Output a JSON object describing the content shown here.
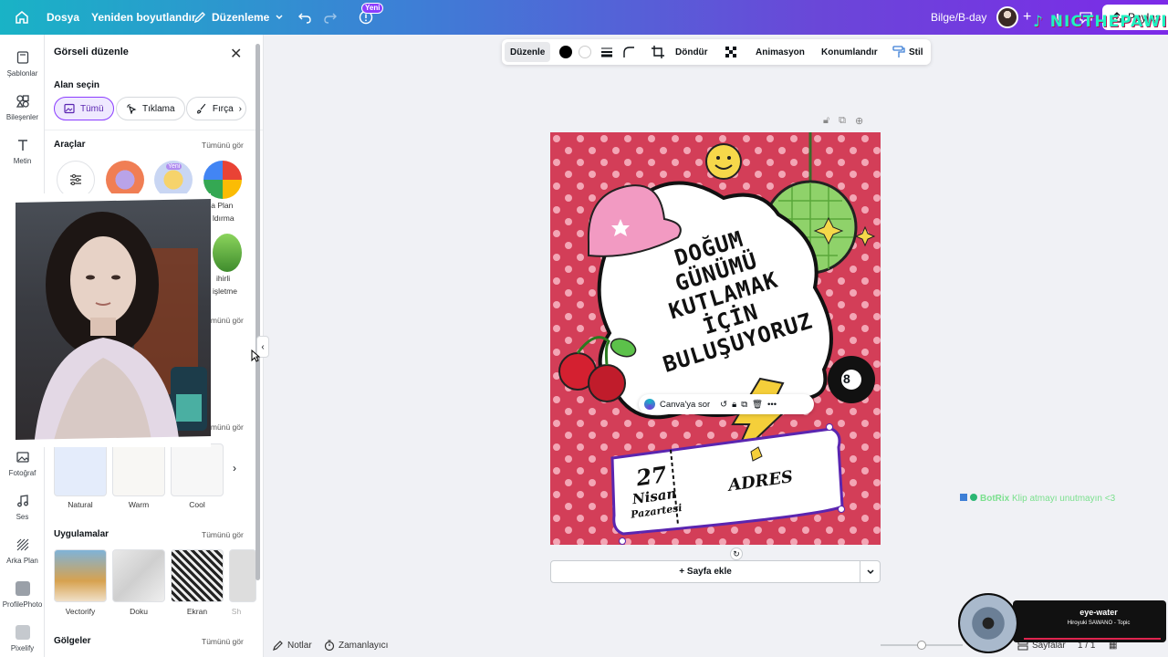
{
  "topbar": {
    "file": "Dosya",
    "resize": "Yeniden boyutlandır",
    "edit": "Düzenleme",
    "new_badge": "Yeni",
    "project_title": "Bilge/B-day",
    "share": "Paylaş",
    "tiktok_handle": "NICTHEPAWICH"
  },
  "rail": {
    "items": [
      "Şablonlar",
      "Bileşenler",
      "Metin",
      "Fotoğraf",
      "Ses",
      "Arka Plan",
      "ProfilePhoto",
      "Pixelify"
    ]
  },
  "panel": {
    "title": "Görseli düzenle",
    "select_area": "Alan seçin",
    "chips": [
      "Tümü",
      "Tıklama",
      "Fırça"
    ],
    "tools_label": "Araçlar",
    "see_all": "Tümünü gör",
    "tool_new_badge": "Yeni",
    "tool_labels": [
      "ka Plan",
      "ldırma",
      "ihirli",
      "işletme"
    ],
    "filters": [
      "Natural",
      "Warm",
      "Cool"
    ],
    "apps_label": "Uygulamalar",
    "apps": [
      "Vectorify",
      "Doku",
      "Ekran",
      "Sh"
    ],
    "shadows_label": "Gölgeler"
  },
  "context_toolbar": {
    "edit": "Düzenle",
    "rotate": "Döndür",
    "animation": "Animasyon",
    "position": "Konumlandır",
    "style": "Stil"
  },
  "design": {
    "title_lines": [
      "DOĞUM",
      "GÜNÜMÜ",
      "KUTLAMAK",
      "İÇİN",
      "BULUŞUYORUZ"
    ],
    "ticket_day": "27",
    "ticket_month": "Nisan",
    "ticket_weekday": "Pazartesi",
    "ticket_address": "ADRES",
    "ball_number": "8"
  },
  "element_toolbar": {
    "ask": "Canva'ya sor"
  },
  "add_page": "+ Sayfa ekle",
  "bottombar": {
    "notes": "Notlar",
    "timer": "Zamanlayıcı",
    "pages": "Sayfalar",
    "page_count": "1 / 1"
  },
  "chat": {
    "user": "BotRix",
    "message": "Klip atmayı unutmayın <3"
  },
  "music": {
    "title": "eye-water",
    "artist": "Hiroyuki SAWANO - Topic"
  },
  "colors": {
    "design_bg": "#d33e58",
    "accent": "#8b3dff"
  }
}
